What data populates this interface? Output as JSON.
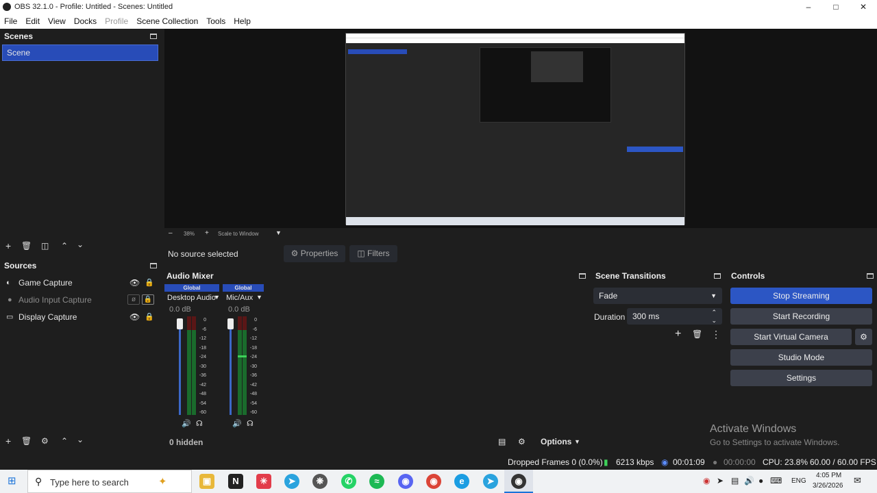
{
  "window": {
    "title": "OBS 32.1.0 - Profile: Untitled - Scenes: Untitled"
  },
  "menu": [
    "File",
    "Edit",
    "View",
    "Docks",
    "Profile",
    "Scene Collection",
    "Tools",
    "Help"
  ],
  "scenes": {
    "header": "Scenes",
    "items": [
      "Scene"
    ]
  },
  "preview": {
    "zoom": "38%",
    "scale_mode": "Scale to Window"
  },
  "context_bar": {
    "selection": "No source selected",
    "properties": "Properties",
    "filters": "Filters"
  },
  "sources": {
    "header": "Sources",
    "items": [
      {
        "name": "Game Capture",
        "visible": true
      },
      {
        "name": "Audio Input Capture",
        "visible": false
      },
      {
        "name": "Display Capture",
        "visible": true
      }
    ]
  },
  "audio_mixer": {
    "header": "Audio Mixer",
    "hidden_label": "0 hidden",
    "options": "Options",
    "channels": [
      {
        "group": "Global",
        "name": "Desktop Audio",
        "db": "0.0 dB"
      },
      {
        "group": "Global",
        "name": "Mic/Aux",
        "db": "0.0 dB"
      }
    ],
    "scale": [
      "0",
      "-6",
      "-12",
      "-18",
      "-24",
      "-30",
      "-36",
      "-42",
      "-48",
      "-54",
      "-60"
    ]
  },
  "scene_transitions": {
    "header": "Scene Transitions",
    "transition": "Fade",
    "duration_label": "Duration",
    "duration_value": "300 ms"
  },
  "controls": {
    "header": "Controls",
    "buttons": [
      "Stop Streaming",
      "Start Recording",
      "Start Virtual Camera",
      "Studio Mode",
      "Settings"
    ]
  },
  "watermark": {
    "title": "Activate Windows",
    "subtitle": "Go to Settings to activate Windows."
  },
  "status": {
    "dropped": "Dropped Frames 0 (0.0%)",
    "bitrate": "6213 kbps",
    "stream_time": "00:01:09",
    "rec_time": "00:00:00",
    "cpu": "CPU: 23.8%",
    "fps": "60.00 / 60.00 FPS"
  },
  "taskbar": {
    "search_placeholder": "Type here to search",
    "lang": "ENG",
    "time": "4:05 PM",
    "date": "3/26/2026"
  },
  "colors": {
    "accent": "#284cb8",
    "panel": "#1e1e1e",
    "button": "#3c404b"
  }
}
